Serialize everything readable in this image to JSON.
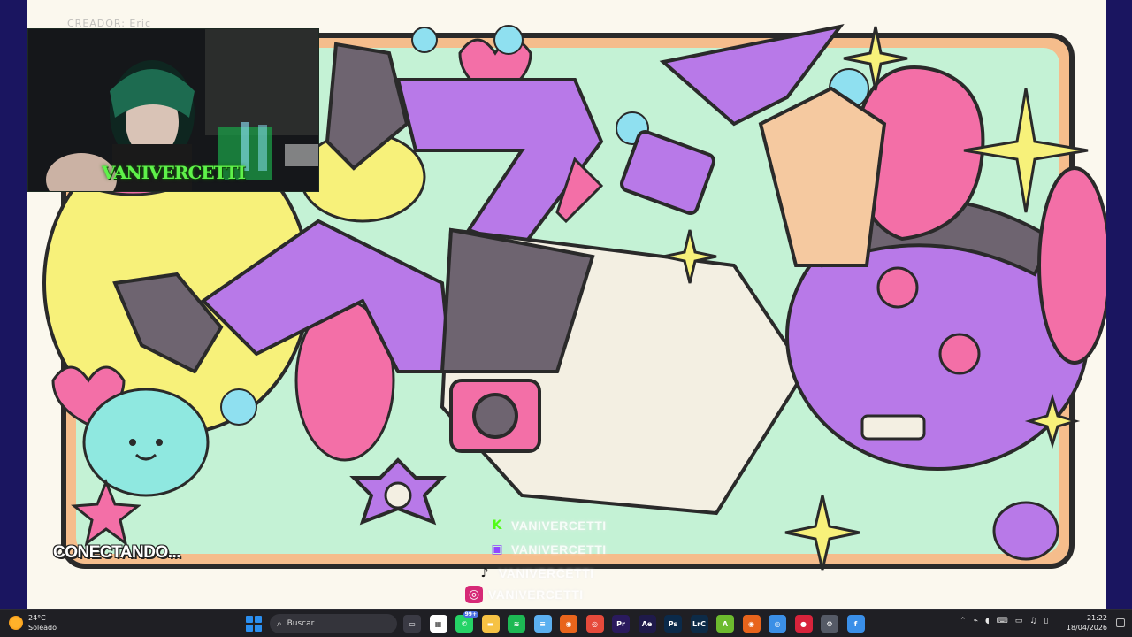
{
  "stream": {
    "creator_label": "CREADOR: Eric",
    "webcam_name": "VANIVERCETTI",
    "status_text": "CONECTANDO...",
    "socials": [
      {
        "platform": "kick",
        "icon": "kick-icon",
        "handle": "VANIVERCETTI",
        "color": "#53fc18"
      },
      {
        "platform": "twitch",
        "icon": "twitch-icon",
        "handle": "VANIVERCETTI",
        "color": "#9146ff"
      },
      {
        "platform": "tiktok",
        "icon": "tiktok-icon",
        "handle": "VANIVERCETTI",
        "color": "#111111"
      },
      {
        "platform": "instagram",
        "icon": "instagram-icon",
        "handle": "VANIVERCETTI",
        "color": "#d62976"
      }
    ]
  },
  "taskbar": {
    "weather": {
      "temperature": "24°C",
      "condition": "Soleado",
      "icon": "sun-icon"
    },
    "search_placeholder": "Buscar",
    "pinned_apps": [
      {
        "name": "task-view",
        "icon": "task-view-icon",
        "color": "#3a3a44",
        "glyph": "▭"
      },
      {
        "name": "microsoft-store",
        "icon": "store-icon",
        "color": "#ffffff",
        "glyph": "▦"
      },
      {
        "name": "whatsapp",
        "icon": "whatsapp-icon",
        "color": "#25d366",
        "glyph": "✆",
        "badge": "99+"
      },
      {
        "name": "file-explorer",
        "icon": "folder-icon",
        "color": "#f6c244",
        "glyph": "▬"
      },
      {
        "name": "spotify",
        "icon": "spotify-icon",
        "color": "#1db954",
        "glyph": "≋"
      },
      {
        "name": "notepad",
        "icon": "notepad-icon",
        "color": "#5cb0f0",
        "glyph": "≡"
      },
      {
        "name": "firefox",
        "icon": "firefox-icon",
        "color": "#e8641c",
        "glyph": "◉"
      },
      {
        "name": "chrome",
        "icon": "chrome-icon",
        "color": "#e64a3b",
        "glyph": "◎"
      },
      {
        "name": "premiere-pro",
        "icon": "premiere-icon",
        "color": "#2a1a5e",
        "glyph": "Pr"
      },
      {
        "name": "after-effects",
        "icon": "after-effects-icon",
        "color": "#1f1a4a",
        "glyph": "Ae"
      },
      {
        "name": "photoshop",
        "icon": "photoshop-icon",
        "color": "#0b2a4a",
        "glyph": "Ps"
      },
      {
        "name": "lightroom-classic",
        "icon": "lightroom-icon",
        "color": "#0d2b47",
        "glyph": "LrC"
      },
      {
        "name": "app-green",
        "icon": "green-app-icon",
        "color": "#6dbb2e",
        "glyph": "A"
      },
      {
        "name": "firefox-2",
        "icon": "firefox-icon",
        "color": "#e8641c",
        "glyph": "◉"
      },
      {
        "name": "chrome-2",
        "icon": "chrome-icon",
        "color": "#3b8fe6",
        "glyph": "◎"
      },
      {
        "name": "obs-record",
        "icon": "record-icon",
        "color": "#d8233b",
        "glyph": "●"
      },
      {
        "name": "settings-app",
        "icon": "gear-icon",
        "color": "#555a66",
        "glyph": "⚙"
      },
      {
        "name": "active-app",
        "icon": "app-icon",
        "color": "#3a8fe8",
        "glyph": "f"
      }
    ],
    "tray_icons": [
      "chevron-up-icon",
      "wifi-off-icon",
      "headset-icon",
      "keyboard-icon",
      "network-icon",
      "volume-icon",
      "battery-icon"
    ],
    "clock": {
      "time": "21:22",
      "date": "18/04/2026"
    }
  }
}
